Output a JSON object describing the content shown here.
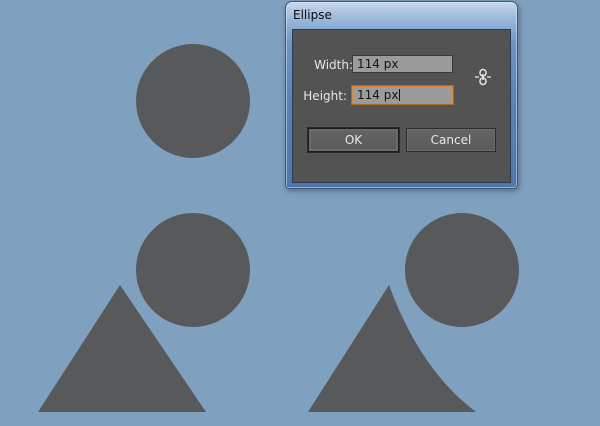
{
  "dialog": {
    "title": "Ellipse",
    "width_label": "Width:",
    "width_value": "114 px",
    "height_label": "Height:",
    "height_value": "114 px",
    "ok_label": "OK",
    "cancel_label": "Cancel",
    "constrain_icon": "link-icon"
  },
  "colors": {
    "artboard": "#7fa1bf",
    "shape_fill": "#58595b",
    "dialog_body": "#535353",
    "focus_ring": "#d68a3c"
  }
}
